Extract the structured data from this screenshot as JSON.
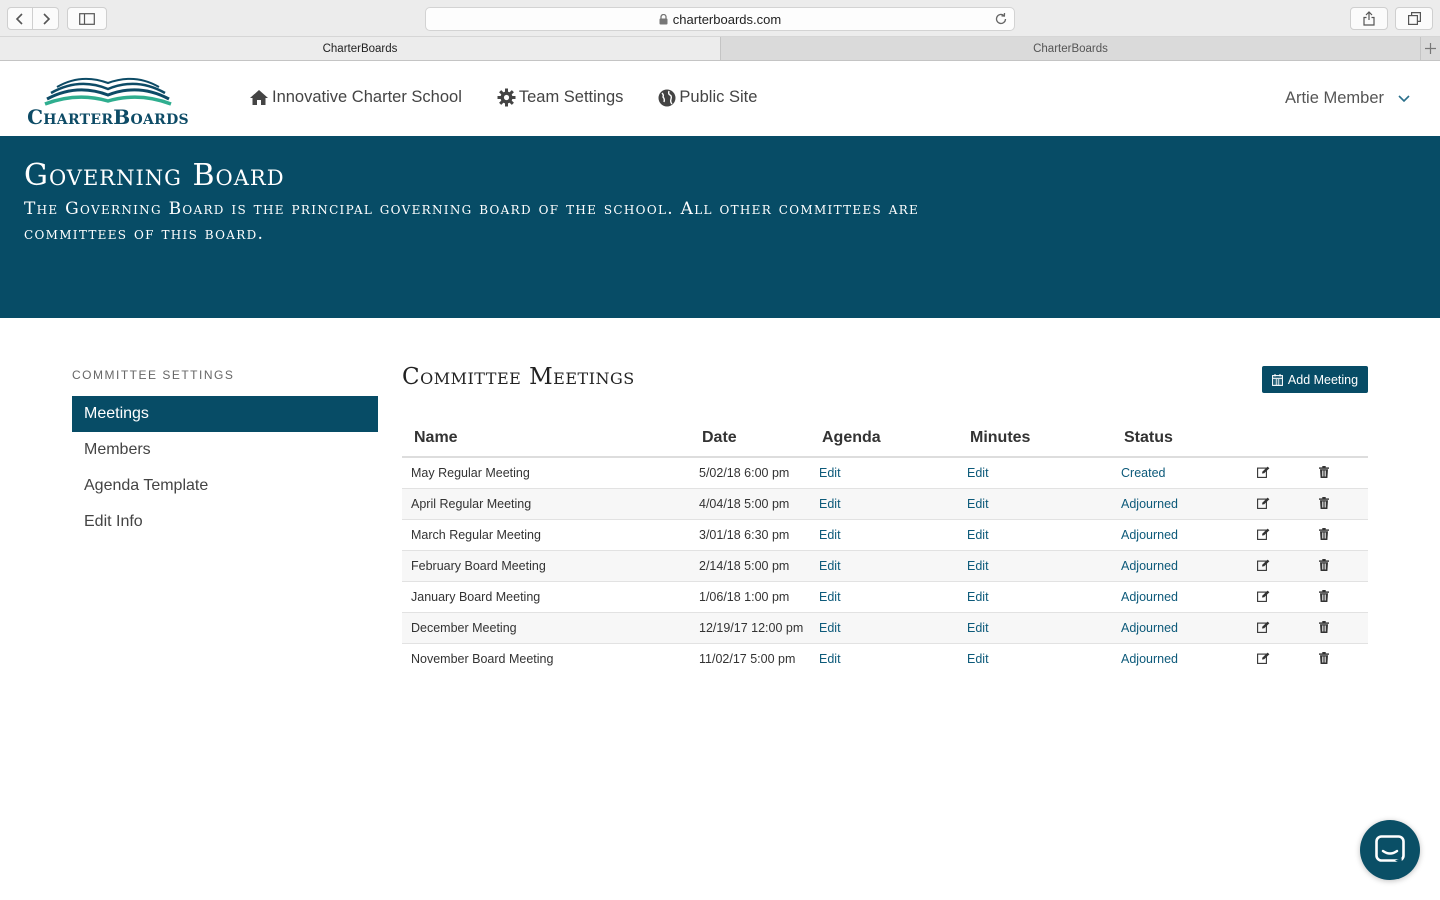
{
  "browser": {
    "url": "charterboards.com",
    "tabs": [
      {
        "label": "CharterBoards"
      },
      {
        "label": "CharterBoards"
      }
    ]
  },
  "header": {
    "logo_text": "CharterBoards",
    "nav": [
      {
        "label": "Innovative Charter School",
        "icon": "home-icon"
      },
      {
        "label": "Team Settings",
        "icon": "gear-icon"
      },
      {
        "label": "Public Site",
        "icon": "globe-icon"
      }
    ],
    "user_name": "Artie Member"
  },
  "hero": {
    "title": "Governing Board",
    "description": "The Governing Board is the principal governing board of the school. All other committees are committees of this board."
  },
  "sidebar": {
    "heading": "COMMITTEE SETTINGS",
    "items": [
      {
        "label": "Meetings",
        "active": true
      },
      {
        "label": "Members",
        "active": false
      },
      {
        "label": "Agenda Template",
        "active": false
      },
      {
        "label": "Edit Info",
        "active": false
      }
    ]
  },
  "main": {
    "title": "Committee Meetings",
    "add_button": "Add Meeting",
    "columns": [
      "Name",
      "Date",
      "Agenda",
      "Minutes",
      "Status"
    ],
    "meetings": [
      {
        "name": "May Regular Meeting",
        "date": "5/02/18 6:00 pm",
        "agenda": "Edit",
        "minutes": "Edit",
        "status": "Created"
      },
      {
        "name": "April Regular Meeting",
        "date": "4/04/18 5:00 pm",
        "agenda": "Edit",
        "minutes": "Edit",
        "status": "Adjourned"
      },
      {
        "name": "March Regular Meeting",
        "date": "3/01/18 6:30 pm",
        "agenda": "Edit",
        "minutes": "Edit",
        "status": "Adjourned"
      },
      {
        "name": "February Board Meeting",
        "date": "2/14/18 5:00 pm",
        "agenda": "Edit",
        "minutes": "Edit",
        "status": "Adjourned"
      },
      {
        "name": "January Board Meeting",
        "date": "1/06/18 1:00 pm",
        "agenda": "Edit",
        "minutes": "Edit",
        "status": "Adjourned"
      },
      {
        "name": "December Meeting",
        "date": "12/19/17 12:00 pm",
        "agenda": "Edit",
        "minutes": "Edit",
        "status": "Adjourned"
      },
      {
        "name": "November Board Meeting",
        "date": "11/02/17 5:00 pm",
        "agenda": "Edit",
        "minutes": "Edit",
        "status": "Adjourned"
      }
    ]
  },
  "colors": {
    "brand": "#074c66",
    "link": "#0d5a7a"
  }
}
